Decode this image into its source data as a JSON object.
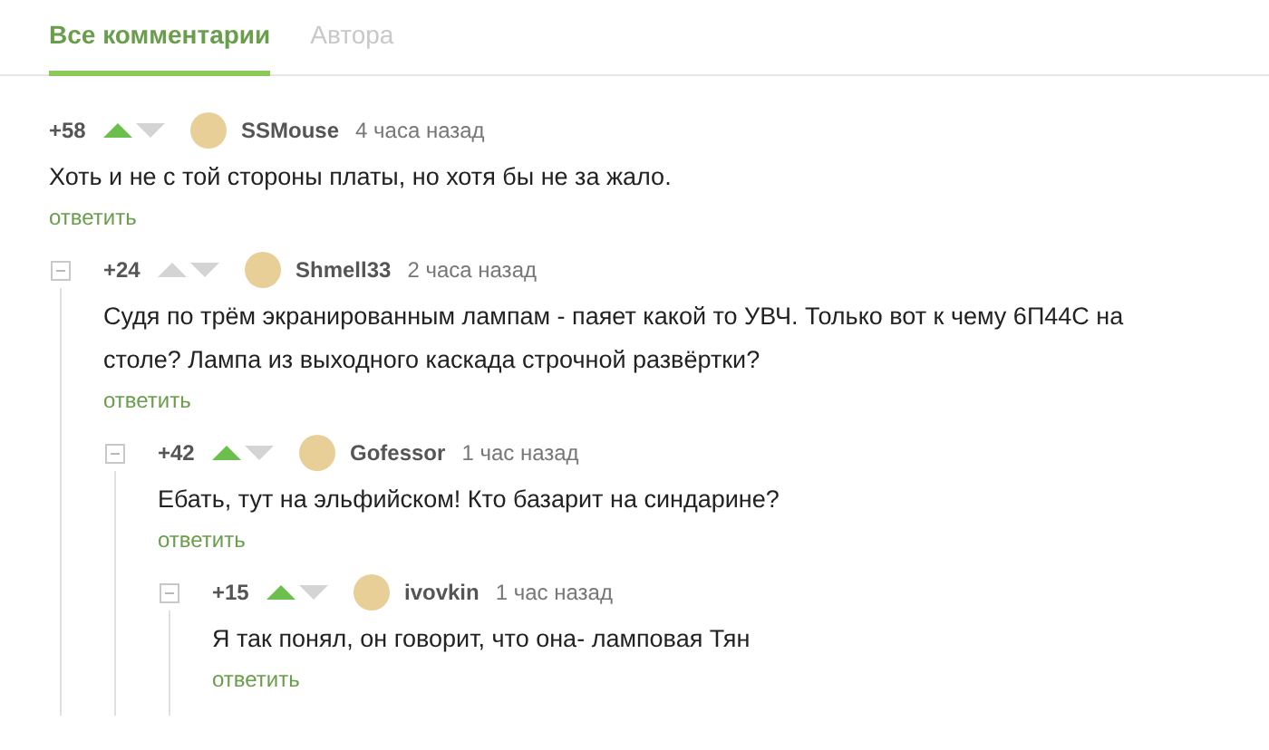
{
  "tabs": [
    {
      "label": "Все комментарии",
      "selected": true
    },
    {
      "label": "Автора",
      "selected": false
    }
  ],
  "comments": [
    {
      "rating": "+58",
      "upvoted": true,
      "author": "SSMouse",
      "time": "4 часа назад",
      "text": "Хоть и не с той стороны платы, но хотя бы не за жало.",
      "reply": "ответить",
      "children": [
        {
          "rating": "+24",
          "upvoted": false,
          "author": "Shmell33",
          "time": "2 часа назад",
          "text": "Судя по трём экранированным лампам - паяет какой то УВЧ. Только вот к чему 6П44С на столе? Лампа из выходного каскада строчной развёртки?",
          "reply": "ответить",
          "children": [
            {
              "rating": "+42",
              "upvoted": true,
              "author": "Gofessor",
              "time": "1 час назад",
              "text": "Ебать, тут на эльфийском! Кто базарит на синдарине?",
              "reply": "ответить",
              "children": [
                {
                  "rating": "+15",
                  "upvoted": true,
                  "author": "ivovkin",
                  "time": "1 час назад",
                  "text": "Я так понял, он говорит, что она- ламповая Тян",
                  "reply": "ответить"
                }
              ]
            }
          ]
        }
      ]
    }
  ]
}
